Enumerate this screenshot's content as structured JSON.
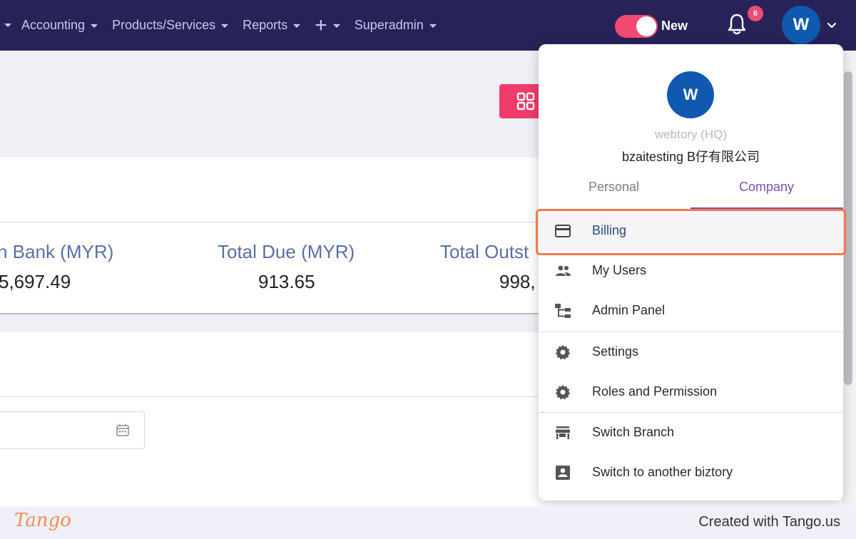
{
  "nav": {
    "items": [
      {
        "label": "Accounting"
      },
      {
        "label": "Products/Services"
      },
      {
        "label": "Reports"
      },
      {
        "label": "+"
      },
      {
        "label": "Superadmin"
      }
    ],
    "toggle_label": "New",
    "notification_count": "6",
    "avatar_initial": "W"
  },
  "summary": {
    "stats": [
      {
        "label": "n Bank (MYR)",
        "value": "5,697.49"
      },
      {
        "label": "Total Due (MYR)",
        "value": "913.65"
      },
      {
        "label": "Total Outst",
        "value": "998,"
      }
    ]
  },
  "dropdown": {
    "avatar_initial": "W",
    "org_name": "webtory (HQ)",
    "company_name": "bzaitesting B仔有限公司",
    "tabs": [
      {
        "label": "Personal"
      },
      {
        "label": "Company"
      }
    ],
    "active_tab": "Company",
    "items": [
      {
        "label": "Billing",
        "icon": "credit-card-icon"
      },
      {
        "label": "My Users",
        "icon": "users-icon"
      },
      {
        "label": "Admin Panel",
        "icon": "hierarchy-icon"
      },
      {
        "label": "Settings",
        "icon": "gear-icon"
      },
      {
        "label": "Roles and Permission",
        "icon": "gear-icon"
      },
      {
        "label": "Switch Branch",
        "icon": "store-icon"
      },
      {
        "label": "Switch to another biztory",
        "icon": "contact-card-icon"
      }
    ],
    "highlighted_item": "Billing"
  },
  "footer": {
    "logo_text": "Tango",
    "credit_text": "Created with Tango.us"
  },
  "colors": {
    "nav_bg": "#272359",
    "accent_pink": "#f24a74",
    "avatar_blue": "#1059b0",
    "highlight_orange": "#f27b4c",
    "tab_purple": "#7a4fb0"
  }
}
